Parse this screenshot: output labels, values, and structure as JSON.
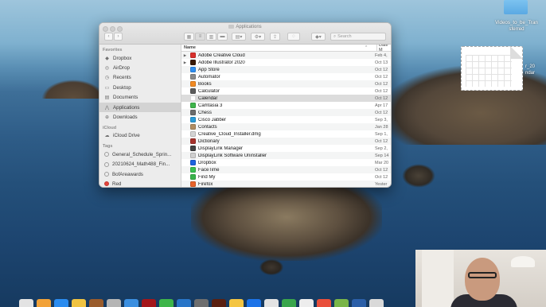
{
  "finder": {
    "title": "Applications",
    "search_placeholder": "Search",
    "sidebar": {
      "favorites_header": "Favorites",
      "favorites": [
        {
          "label": "Dropbox",
          "icon": "dropbox-icon",
          "glyph": "◆"
        },
        {
          "label": "AirDrop",
          "icon": "airdrop-icon",
          "glyph": "◎"
        },
        {
          "label": "Recents",
          "icon": "clock-icon",
          "glyph": "◷"
        },
        {
          "label": "Desktop",
          "icon": "desktop-icon",
          "glyph": "▭"
        },
        {
          "label": "Documents",
          "icon": "document-icon",
          "glyph": "▤"
        },
        {
          "label": "Applications",
          "icon": "applications-icon",
          "glyph": "⋀",
          "selected": true
        },
        {
          "label": "Downloads",
          "icon": "download-icon",
          "glyph": "⊕"
        }
      ],
      "icloud_header": "iCloud",
      "icloud": [
        {
          "label": "iCloud Drive",
          "icon": "cloud-icon",
          "glyph": "☁"
        }
      ],
      "tags_header": "Tags",
      "tags": [
        {
          "label": "General_Schedule_Sprin...",
          "color": ""
        },
        {
          "label": "20210624_Math488_Fin...",
          "color": ""
        },
        {
          "label": "BofAreawards",
          "color": ""
        },
        {
          "label": "Red",
          "color": "red"
        }
      ]
    },
    "columns": {
      "name": "Name",
      "date": "Date M"
    },
    "rows": [
      {
        "name": "Adobe Creative Cloud",
        "date": "Feb 4,",
        "disclosure": "▶",
        "icon_color": "#d9302c"
      },
      {
        "name": "Adobe Illustrator 2020",
        "date": "Oct 13",
        "disclosure": "▶",
        "icon_color": "#3a1a06"
      },
      {
        "name": "App Store",
        "date": "Oct 12",
        "disclosure": "",
        "icon_color": "#2f8ef0"
      },
      {
        "name": "Automator",
        "date": "Oct 12",
        "disclosure": "",
        "icon_color": "#8a8a8a"
      },
      {
        "name": "Books",
        "date": "Oct 12",
        "disclosure": "",
        "icon_color": "#f28a22"
      },
      {
        "name": "Calculator",
        "date": "Oct 12",
        "disclosure": "",
        "icon_color": "#5b5b5b"
      },
      {
        "name": "Calendar",
        "date": "Oct 12",
        "disclosure": "",
        "icon_color": "#ffffff",
        "selected": true
      },
      {
        "name": "Camtasia 3",
        "date": "Apr 17",
        "disclosure": "",
        "icon_color": "#3eb54a"
      },
      {
        "name": "Chess",
        "date": "Oct 12",
        "disclosure": "",
        "icon_color": "#6b6b6b"
      },
      {
        "name": "Cisco Jabber",
        "date": "Sep 3,",
        "disclosure": "",
        "icon_color": "#2a9bd8"
      },
      {
        "name": "Contacts",
        "date": "Jan 28",
        "disclosure": "",
        "icon_color": "#b08d62"
      },
      {
        "name": "Creative_Cloud_Installer.dmg",
        "date": "Sep 1,",
        "disclosure": "",
        "icon_color": "#d4d4d4"
      },
      {
        "name": "Dictionary",
        "date": "Oct 12",
        "disclosure": "",
        "icon_color": "#a7322c"
      },
      {
        "name": "DisplayLink Manager",
        "date": "Sep 2,",
        "disclosure": "",
        "icon_color": "#444444"
      },
      {
        "name": "DisplayLink Software Uninstaller",
        "date": "Sep 14",
        "disclosure": "",
        "icon_color": "#cfcfcf"
      },
      {
        "name": "Dropbox",
        "date": "Mar 20",
        "disclosure": "",
        "icon_color": "#1d63e0"
      },
      {
        "name": "FaceTime",
        "date": "Oct 12",
        "disclosure": "",
        "icon_color": "#3ac150"
      },
      {
        "name": "Find My",
        "date": "Oct 12",
        "disclosure": "",
        "icon_color": "#38b34a"
      },
      {
        "name": "Firefox",
        "date": "Yester",
        "disclosure": "",
        "icon_color": "#e8632b"
      }
    ]
  },
  "desktop": {
    "folder_label": "Videos_to_be_Transferred",
    "folder_label_line1": "Videos_to_be_Tran",
    "folder_label_line2": "sferred",
    "doc_label_line1": "r_20",
    "doc_label_line2": "ndar"
  },
  "dock": {
    "colors": [
      "#e3e3e3",
      "#f2a238",
      "#2a8cf0",
      "#f0c341",
      "#9a5c2c",
      "#b5b5b5",
      "#3b8fe0",
      "#a4161a",
      "#3eb54a",
      "#2875c8",
      "#6e6e6e",
      "#5a1f10",
      "#f4c542",
      "#1c73e8",
      "#e3e3e3",
      "#3aa64c",
      "#ededed",
      "#e94f3b",
      "#7ab648",
      "#2b5fa8",
      "#d9d9d9"
    ]
  }
}
